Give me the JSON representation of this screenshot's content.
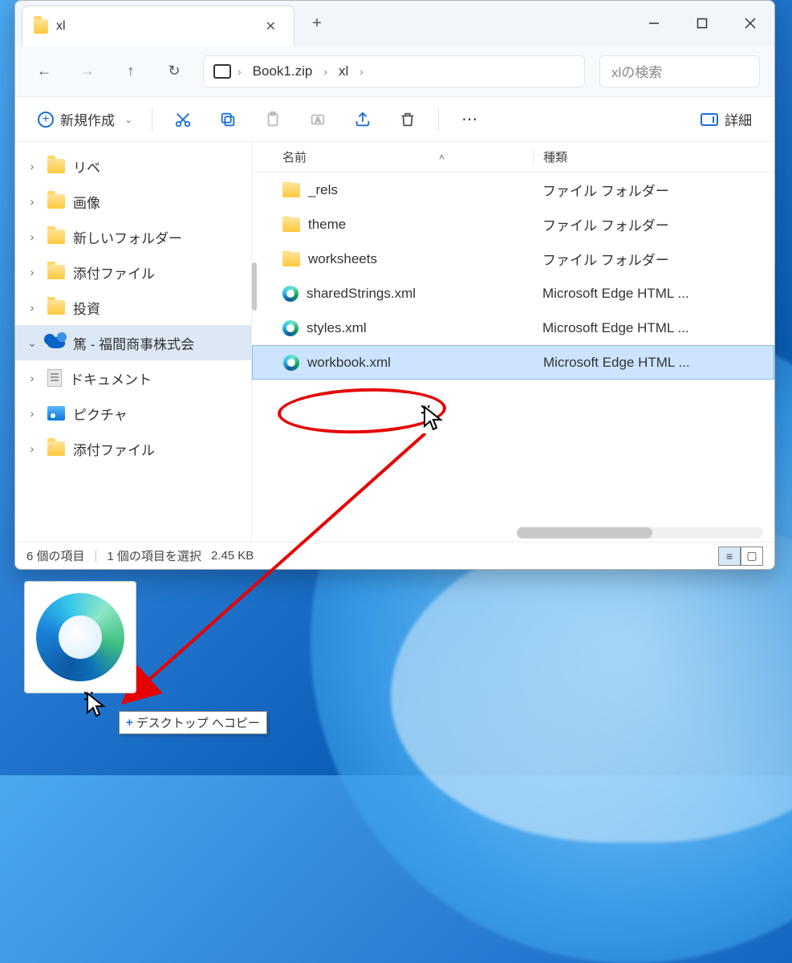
{
  "tab": {
    "title": "xl"
  },
  "breadcrumb": {
    "seg1": "Book1.zip",
    "seg2": "xl"
  },
  "search": {
    "placeholder": "xlの検索"
  },
  "toolbar": {
    "new_label": "新規作成",
    "detail_label": "詳細"
  },
  "columns": {
    "name": "名前",
    "type": "種類"
  },
  "tree": {
    "items": [
      {
        "label": "リベ"
      },
      {
        "label": "画像"
      },
      {
        "label": "新しいフォルダー"
      },
      {
        "label": "添付ファイル"
      },
      {
        "label": "投資"
      },
      {
        "label": "篤 - 福間商事株式会"
      },
      {
        "label": "ドキュメント"
      },
      {
        "label": "ピクチャ"
      },
      {
        "label": "添付ファイル"
      }
    ]
  },
  "files": [
    {
      "name": "_rels",
      "type": "ファイル フォルダー",
      "icon": "folder"
    },
    {
      "name": "theme",
      "type": "ファイル フォルダー",
      "icon": "folder"
    },
    {
      "name": "worksheets",
      "type": "ファイル フォルダー",
      "icon": "folder"
    },
    {
      "name": "sharedStrings.xml",
      "type": "Microsoft Edge HTML ...",
      "icon": "edge"
    },
    {
      "name": "styles.xml",
      "type": "Microsoft Edge HTML ...",
      "icon": "edge"
    },
    {
      "name": "workbook.xml",
      "type": "Microsoft Edge HTML ...",
      "icon": "edge"
    }
  ],
  "status": {
    "count": "6 個の項目",
    "selection": "1 個の項目を選択",
    "size": "2.45 KB"
  },
  "drop_tip": "デスクトップ へコピー"
}
